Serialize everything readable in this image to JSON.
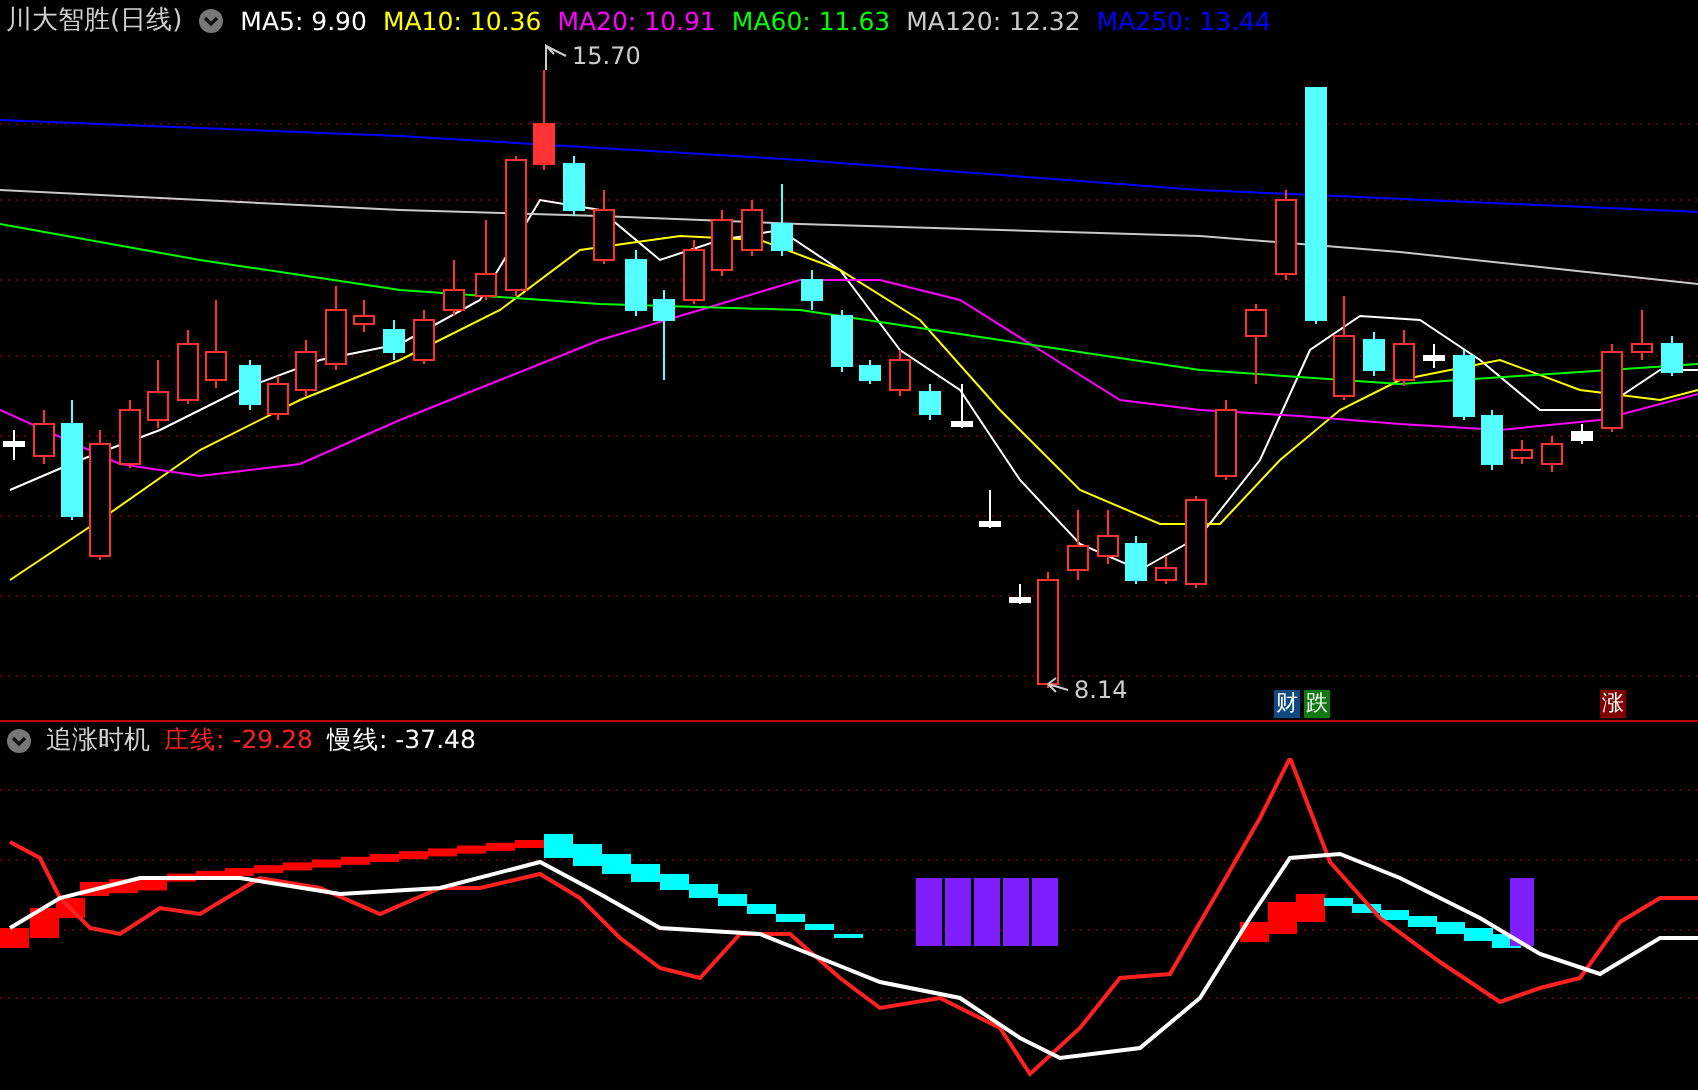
{
  "chart": {
    "title": "川大智胜(日线)",
    "ma_legend": [
      {
        "text": "MA5: 9.90",
        "color": "#ffffff"
      },
      {
        "text": "MA10: 10.36",
        "color": "#ffff00"
      },
      {
        "text": "MA20: 10.91",
        "color": "#ff00ff"
      },
      {
        "text": "MA60: 11.63",
        "color": "#00ff00"
      },
      {
        "text": "MA120: 12.32",
        "color": "#c8c8c8"
      },
      {
        "text": "MA250: 13.44",
        "color": "#0000ff"
      }
    ],
    "high_label": "15.70",
    "low_label": "8.14",
    "signals": [
      {
        "text": "财",
        "color": "#104a80"
      },
      {
        "text": "跌",
        "color": "#107a10"
      },
      {
        "text": "涨",
        "color": "#800000"
      }
    ]
  },
  "indicator": {
    "title": "追涨时机",
    "lines": [
      {
        "text": "庄线: -29.28",
        "color": "#ff2020"
      },
      {
        "text": "慢线: -37.48",
        "color": "#ffffff"
      }
    ]
  }
}
